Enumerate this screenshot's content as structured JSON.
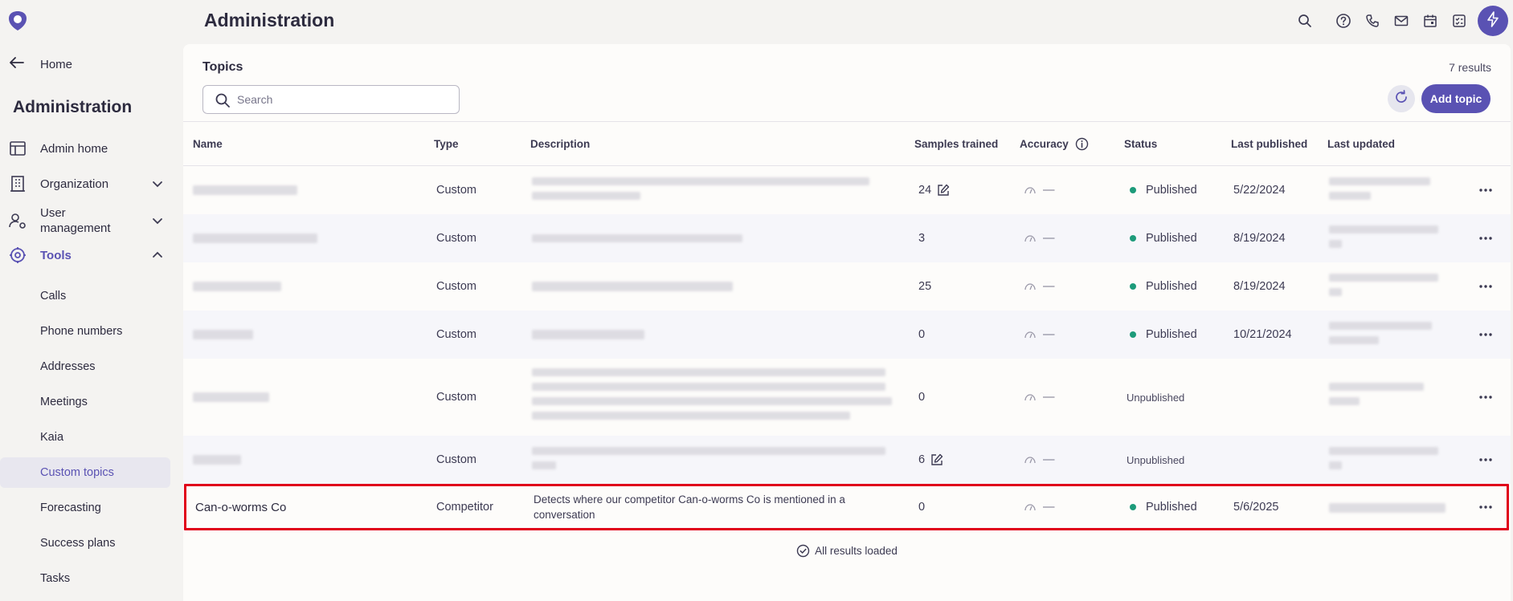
{
  "app": {
    "page_title": "Administration"
  },
  "sidebar": {
    "home": "Home",
    "title": "Administration",
    "items": [
      {
        "label": "Admin home",
        "icon": "layout-icon"
      },
      {
        "label": "Organization",
        "icon": "building-icon"
      },
      {
        "label": "User management",
        "icon": "user-gear-icon"
      },
      {
        "label": "Tools",
        "icon": "tools-icon"
      }
    ],
    "sub_items": [
      "Calls",
      "Phone numbers",
      "Addresses",
      "Meetings",
      "Kaia",
      "Custom topics",
      "Forecasting",
      "Success plans",
      "Tasks"
    ],
    "active_sub": "Custom topics"
  },
  "panel": {
    "title": "Topics",
    "result_count": "7 results",
    "search_placeholder": "Search",
    "search_value": "",
    "add_label": "Add topic",
    "all_loaded": "All results loaded"
  },
  "table": {
    "columns": [
      "Name",
      "Type",
      "Description",
      "Samples trained",
      "Accuracy",
      "Status",
      "Last published",
      "Last updated"
    ],
    "rows": [
      {
        "name": "",
        "type": "Custom",
        "description": "",
        "samples": "24",
        "samples_editable": true,
        "accuracy": "—",
        "status": "Published",
        "last_published": "5/22/2024",
        "last_updated": ""
      },
      {
        "name": "",
        "type": "Custom",
        "description": "",
        "samples": "3",
        "samples_editable": false,
        "accuracy": "—",
        "status": "Published",
        "last_published": "8/19/2024",
        "last_updated": ""
      },
      {
        "name": "",
        "type": "Custom",
        "description": "",
        "samples": "25",
        "samples_editable": false,
        "accuracy": "—",
        "status": "Published",
        "last_published": "8/19/2024",
        "last_updated": ""
      },
      {
        "name": "",
        "type": "Custom",
        "description": "",
        "samples": "0",
        "samples_editable": false,
        "accuracy": "—",
        "status": "Published",
        "last_published": "10/21/2024",
        "last_updated": ""
      },
      {
        "name": "",
        "type": "Custom",
        "description": "",
        "samples": "0",
        "samples_editable": false,
        "accuracy": "—",
        "status": "Unpublished",
        "last_published": "",
        "last_updated": ""
      },
      {
        "name": "",
        "type": "Custom",
        "description": "",
        "samples": "6",
        "samples_editable": true,
        "accuracy": "—",
        "status": "Unpublished",
        "last_published": "",
        "last_updated": ""
      },
      {
        "name": "Can-o-worms Co",
        "type": "Competitor",
        "description": "Detects where our competitor Can-o-worms Co is mentioned in a conversation",
        "samples": "0",
        "samples_editable": false,
        "accuracy": "—",
        "status": "Published",
        "last_published": "5/6/2025",
        "last_updated": ""
      }
    ]
  },
  "colors": {
    "accent": "#5a52b3",
    "published_dot": "#1d9b7a",
    "highlight": "#e0001a"
  }
}
